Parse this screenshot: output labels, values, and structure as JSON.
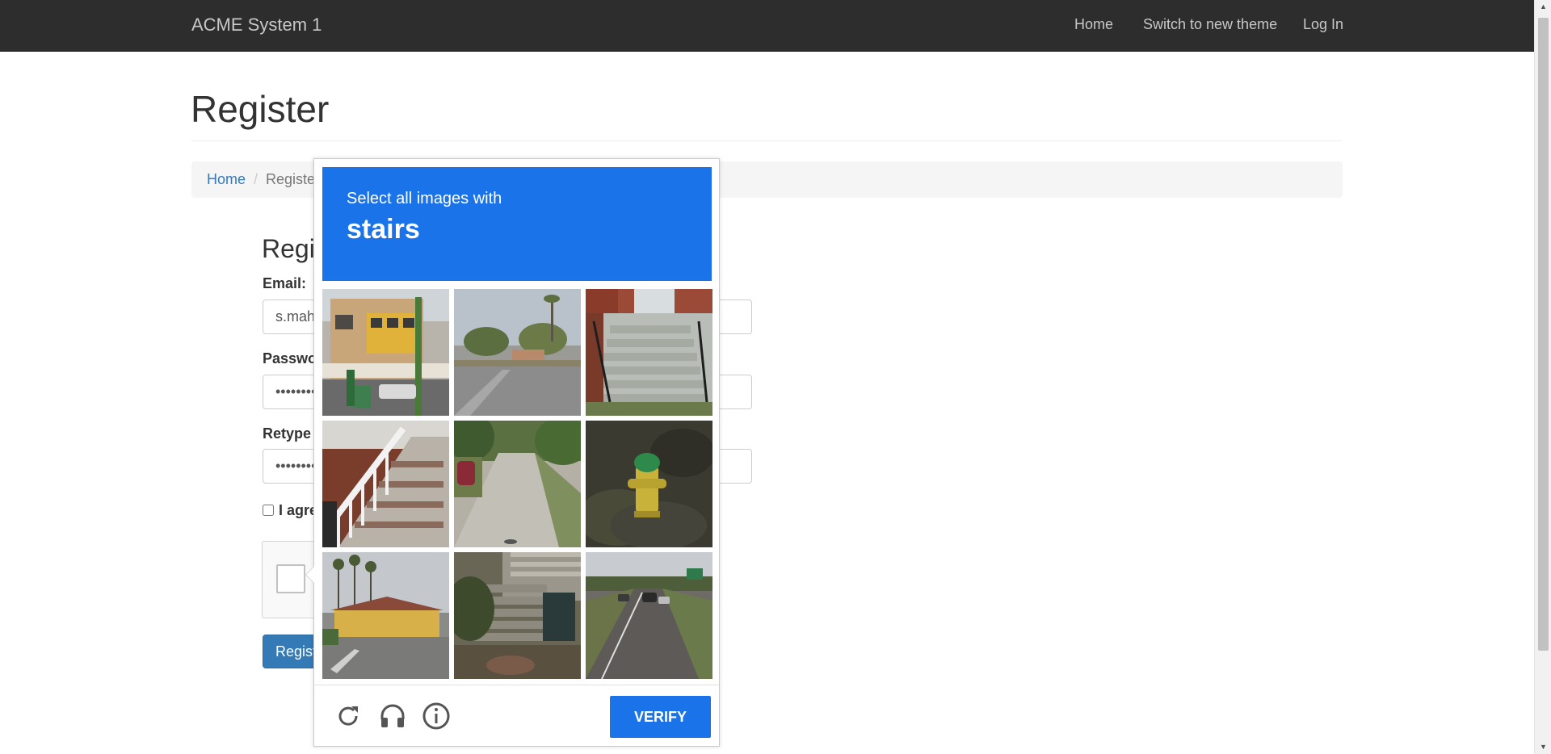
{
  "navbar": {
    "brand": "ACME System 1",
    "links": [
      "Home",
      "Switch to new theme",
      "Log In"
    ]
  },
  "page": {
    "title": "Register",
    "breadcrumb": {
      "home": "Home",
      "current": "Registe"
    }
  },
  "form": {
    "heading": "Regi",
    "email_label": "Email:",
    "email_value": "s.mah",
    "password_label": "Passwo",
    "password_value": "••••••••",
    "retype_label": "Retype",
    "retype_value": "••••••••",
    "agree_label": "I agre",
    "register_label": "Regist"
  },
  "captcha": {
    "prompt_line": "Select all images with",
    "prompt_target": "stairs",
    "tiles": [
      "building-street-scene",
      "palm-trees-road",
      "concrete-stairs-brick-wall",
      "white-railing-stairs",
      "residential-road",
      "fire-hydrant",
      "yellow-house-street",
      "stone-stairs-shrubs",
      "highway-traffic"
    ],
    "icons": [
      "reload-icon",
      "audio-icon",
      "info-icon"
    ],
    "verify_label": "VERIFY"
  },
  "colors": {
    "navbar_bg": "#2d2d2d",
    "accent_blue": "#1a73e8",
    "link_blue": "#337ab7"
  }
}
